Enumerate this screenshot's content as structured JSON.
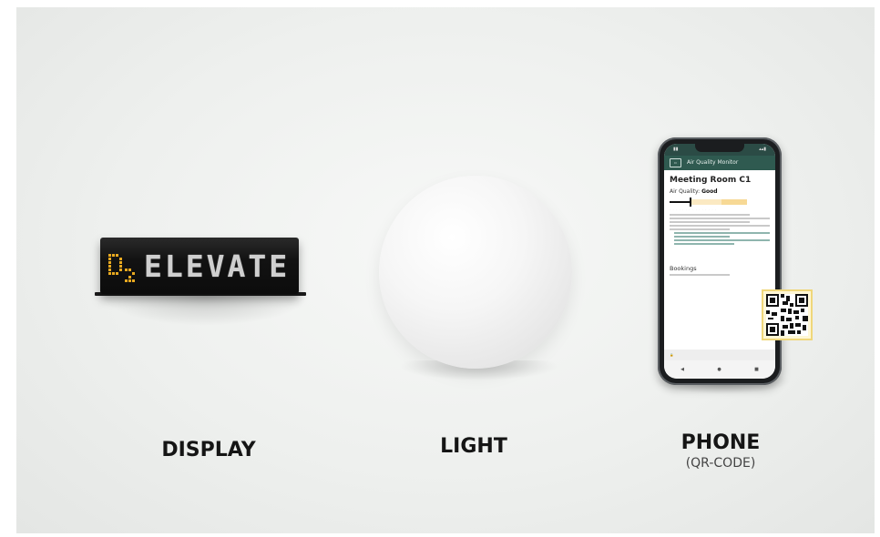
{
  "products": {
    "display": {
      "label": "DISPLAY",
      "screen_text": "ELEVATE"
    },
    "light": {
      "label": "LIGHT"
    },
    "phone": {
      "label": "PHONE",
      "sublabel": "(QR-CODE)",
      "screen": {
        "app_title": "Air Quality Monitor",
        "room": "Meeting Room C1",
        "air_quality_label": "Air Quality:",
        "air_quality_value": "Good",
        "bookings_title": "Bookings"
      }
    }
  },
  "colors": {
    "background": "#eef0ee",
    "display_pixels": "#e8a920",
    "app_bar": "#2f5a50",
    "qr_highlight": "#f0d77a"
  }
}
